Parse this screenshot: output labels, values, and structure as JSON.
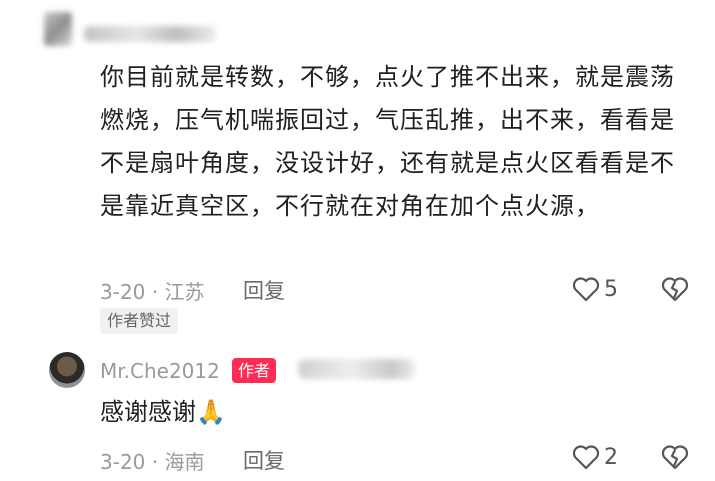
{
  "comment1": {
    "text": "你目前就是转数，不够，点火了推不出来，就是震荡燃烧，压气机喘振回过，气压乱推，出不来，看看是不是扇叶角度，没设计好，还有就是点火区看看是不是靠近真空区，不行就在对角在加个点火源，",
    "date_location": "3-20 · 江苏",
    "reply_label": "回复",
    "like_count": "5",
    "author_liked_badge": "作者赞过"
  },
  "comment2": {
    "username": "Mr.Che2012",
    "author_tag": "作者",
    "text": "感谢感谢🙏",
    "date_location": "3-20 · 海南",
    "reply_label": "回复",
    "like_count": "2"
  },
  "colors": {
    "author_tag": "#fe2c55",
    "meta": "#9a9a9a"
  },
  "icons": [
    "heart-outline-icon",
    "broken-heart-icon"
  ]
}
